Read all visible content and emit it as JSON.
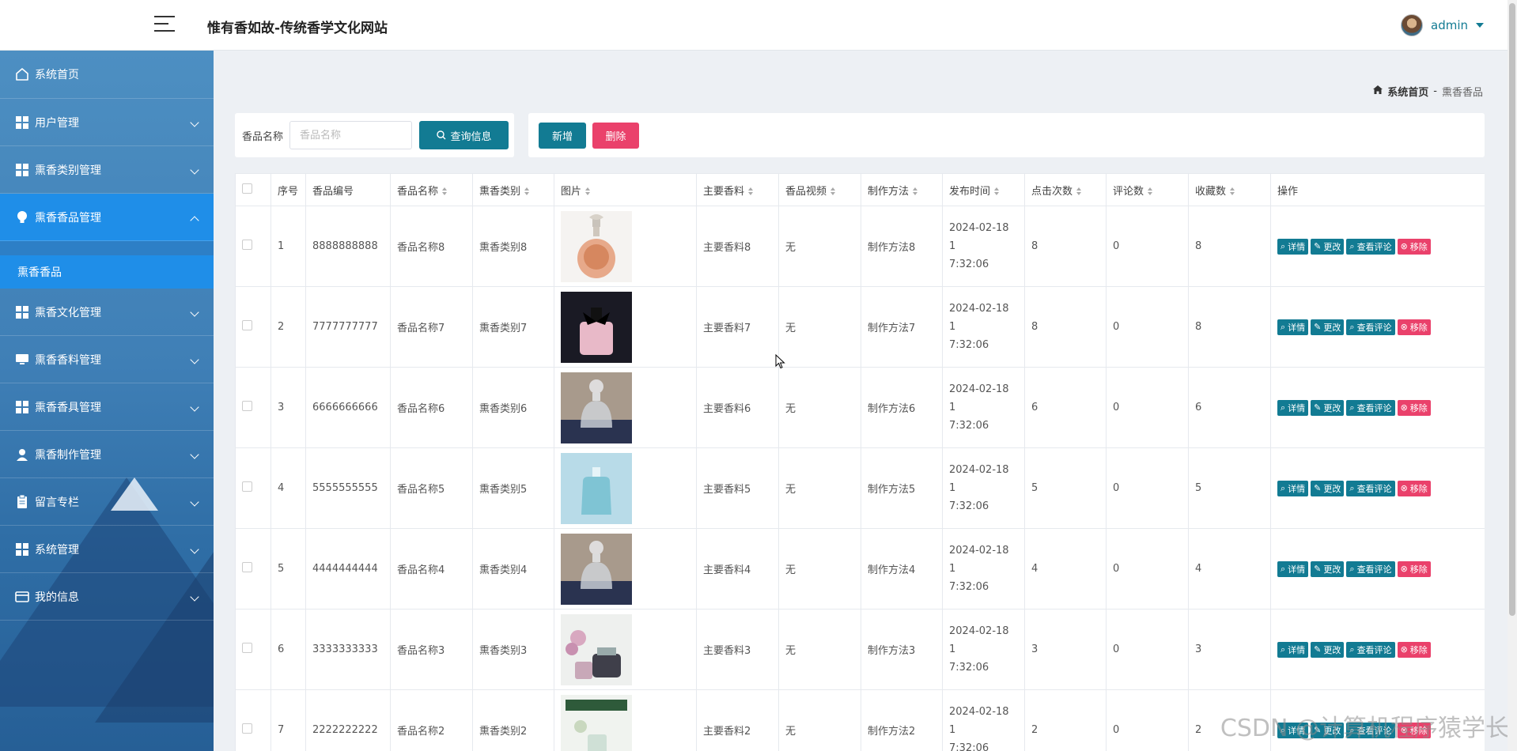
{
  "header": {
    "title": "惟有香如故-传统香学文化网站",
    "user": "admin"
  },
  "sidebar": {
    "items": [
      {
        "label": "系统首页",
        "icon": "home-icon",
        "expandable": false
      },
      {
        "label": "用户管理",
        "icon": "grid-icon",
        "expandable": true
      },
      {
        "label": "熏香类别管理",
        "icon": "grid-icon",
        "expandable": true
      },
      {
        "label": "熏香香品管理",
        "icon": "lightbulb-icon",
        "expandable": true,
        "active": true
      },
      {
        "label": "熏香文化管理",
        "icon": "grid-icon",
        "expandable": true
      },
      {
        "label": "熏香香料管理",
        "icon": "monitor-icon",
        "expandable": true
      },
      {
        "label": "熏香香具管理",
        "icon": "grid-icon",
        "expandable": true
      },
      {
        "label": "熏香制作管理",
        "icon": "user-icon",
        "expandable": true
      },
      {
        "label": "留言专栏",
        "icon": "clipboard-icon",
        "expandable": true
      },
      {
        "label": "系统管理",
        "icon": "grid-icon",
        "expandable": true
      },
      {
        "label": "我的信息",
        "icon": "card-icon",
        "expandable": true
      }
    ],
    "submenu": {
      "label": "熏香香品"
    }
  },
  "breadcrumb": {
    "home": "系统首页",
    "separator": "-",
    "current": "熏香香品"
  },
  "search": {
    "label": "香品名称",
    "placeholder": "香品名称",
    "button": "查询信息"
  },
  "actions": {
    "add": "新增",
    "delete": "删除"
  },
  "table": {
    "columns": [
      "序号",
      "香品编号",
      "香品名称",
      "熏香类别",
      "图片",
      "主要香料",
      "香品视频",
      "制作方法",
      "发布时间",
      "点击次数",
      "评论数",
      "收藏数",
      "操作"
    ],
    "op_buttons": {
      "detail": "详情",
      "edit": "更改",
      "comments": "查看评论",
      "remove": "移除"
    },
    "rows": [
      {
        "idx": "1",
        "code": "8888888888",
        "name": "香品名称8",
        "category": "熏香类别8",
        "spice": "主要香料8",
        "video": "无",
        "method": "制作方法8",
        "time1": "2024-02-18 1",
        "time2": "7:32:06",
        "clicks": "8",
        "comments": "0",
        "favorites": "8",
        "image": "perfume-gold"
      },
      {
        "idx": "2",
        "code": "7777777777",
        "name": "香品名称7",
        "category": "熏香类别7",
        "spice": "主要香料7",
        "video": "无",
        "method": "制作方法7",
        "time1": "2024-02-18 1",
        "time2": "7:32:06",
        "clicks": "8",
        "comments": "0",
        "favorites": "8",
        "image": "perfume-pink"
      },
      {
        "idx": "3",
        "code": "6666666666",
        "name": "香品名称6",
        "category": "熏香类别6",
        "spice": "主要香料6",
        "video": "无",
        "method": "制作方法6",
        "time1": "2024-02-18 1",
        "time2": "7:32:06",
        "clicks": "6",
        "comments": "0",
        "favorites": "6",
        "image": "perfume-clear-dark"
      },
      {
        "idx": "4",
        "code": "5555555555",
        "name": "香品名称5",
        "category": "熏香类别5",
        "spice": "主要香料5",
        "video": "无",
        "method": "制作方法5",
        "time1": "2024-02-18 1",
        "time2": "7:32:06",
        "clicks": "5",
        "comments": "0",
        "favorites": "5",
        "image": "perfume-aqua"
      },
      {
        "idx": "5",
        "code": "4444444444",
        "name": "香品名称4",
        "category": "熏香类别4",
        "spice": "主要香料4",
        "video": "无",
        "method": "制作方法4",
        "time1": "2024-02-18 1",
        "time2": "7:32:06",
        "clicks": "4",
        "comments": "0",
        "favorites": "4",
        "image": "perfume-clear-dark"
      },
      {
        "idx": "6",
        "code": "3333333333",
        "name": "香品名称3",
        "category": "熏香类别3",
        "spice": "主要香料3",
        "video": "无",
        "method": "制作方法3",
        "time1": "2024-02-18 1",
        "time2": "7:32:06",
        "clicks": "3",
        "comments": "0",
        "favorites": "3",
        "image": "perfume-floral"
      },
      {
        "idx": "7",
        "code": "2222222222",
        "name": "香品名称2",
        "category": "熏香类别2",
        "spice": "主要香料2",
        "video": "无",
        "method": "制作方法2",
        "time1": "2024-02-18 1",
        "time2": "7:32:06",
        "clicks": "2",
        "comments": "0",
        "favorites": "2",
        "image": "perfume-green"
      }
    ]
  },
  "watermark": "CSDN @计算机程序猿学长",
  "colors": {
    "primary": "#127b93",
    "danger": "#ea416b",
    "sidebar_active": "#1f8ee8"
  }
}
